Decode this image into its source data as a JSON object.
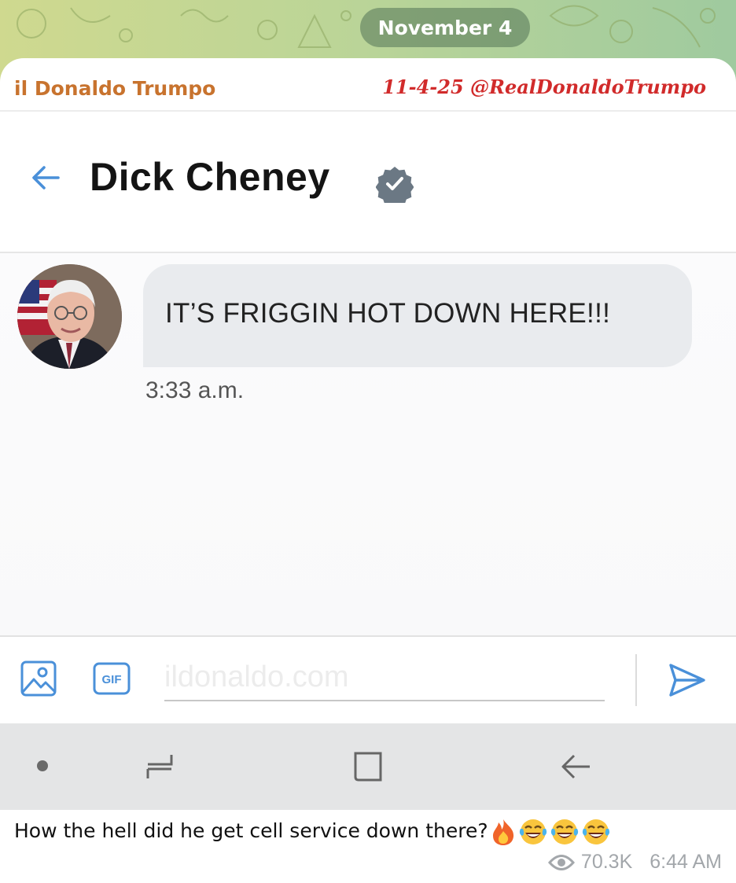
{
  "date_pill": "November 4",
  "post": {
    "sender": "il Donaldo Trumpo",
    "signature": "11-4-25 @RealDonaldoTrumpo",
    "caption": "How the hell did he get cell service down there?",
    "caption_emojis": [
      "fire",
      "tears-of-joy",
      "tears-of-joy",
      "tears-of-joy"
    ],
    "views": "70.3K",
    "time": "6:44 AM"
  },
  "screenshot": {
    "header": {
      "contact_name": "Dick Cheney",
      "verified": true
    },
    "message": {
      "text": "IT’S FRIGGIN HOT DOWN HERE!!!",
      "time": "3:33 a.m."
    },
    "composer": {
      "placeholder": "ildonaldo.com"
    },
    "colors": {
      "accent": "#4a90d9",
      "bubble": "#e9ebee",
      "sender": "#c8732e",
      "signature": "#d12b2b"
    }
  }
}
